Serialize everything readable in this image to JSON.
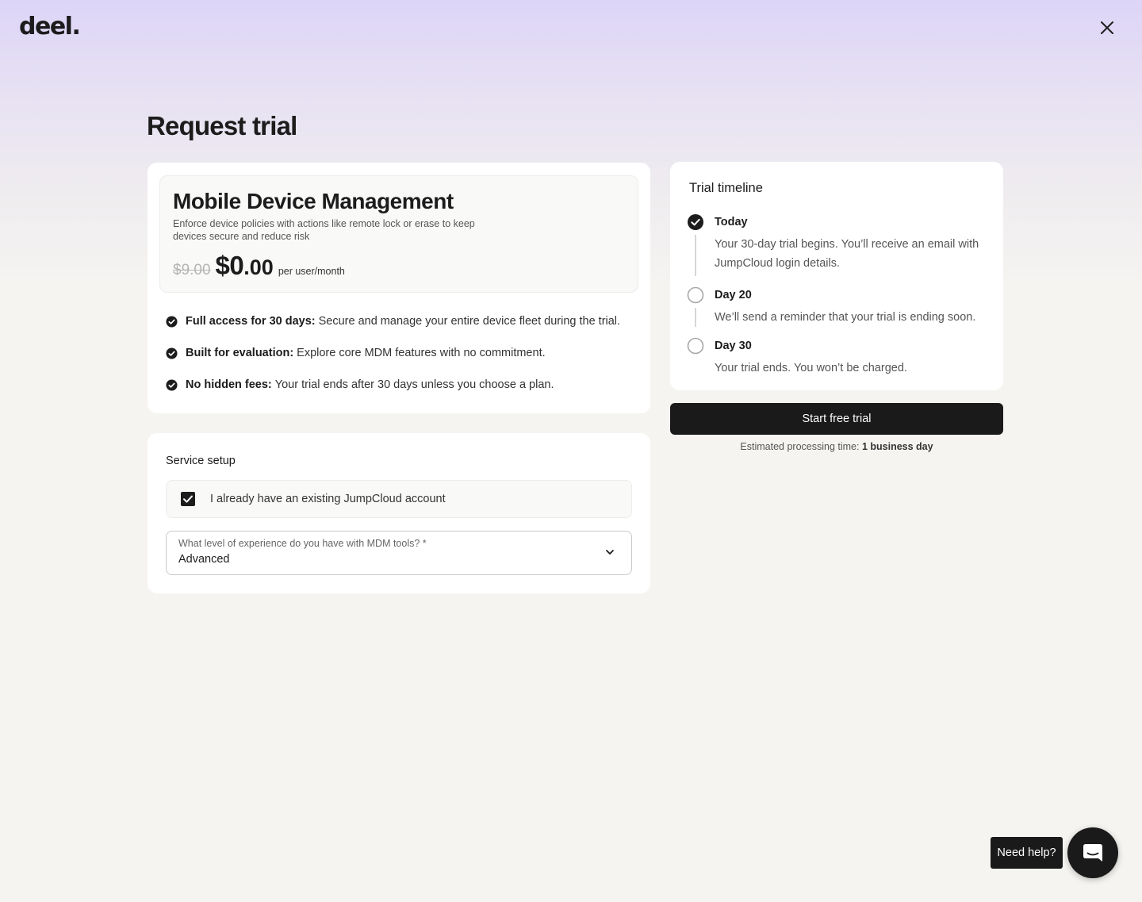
{
  "brand": {
    "logo": "deel."
  },
  "header": {
    "close_icon": "close-icon"
  },
  "page": {
    "title": "Request trial"
  },
  "product": {
    "name": "Mobile Device Management",
    "description": "Enforce device policies with actions like remote lock or erase to keep devices secure and reduce risk",
    "old_price": "$9.00",
    "new_price_major": "$0",
    "new_price_minor": ".00",
    "price_unit": "per user/month",
    "features": [
      {
        "title": "Full access for 30 days:",
        "text": "Secure and manage your entire device fleet during the trial."
      },
      {
        "title": "Built for evaluation:",
        "text": "Explore core MDM features with no commitment."
      },
      {
        "title": "No hidden fees:",
        "text": "Your trial ends after 30 days unless you choose a plan."
      }
    ]
  },
  "setup": {
    "title": "Service setup",
    "checkbox_label": "I already have an existing JumpCloud account",
    "checkbox_checked": true,
    "select_label": "What level of experience do you have with MDM tools? *",
    "select_value": "Advanced"
  },
  "timeline": {
    "title": "Trial timeline",
    "steps": [
      {
        "label": "Today",
        "description": "Your 30-day trial begins. You’ll receive an email with JumpCloud login details.",
        "completed": true
      },
      {
        "label": "Day 20",
        "description": "We’ll send a reminder that your trial is ending soon.",
        "completed": false
      },
      {
        "label": "Day 30",
        "description": "Your trial ends. You won’t be charged.",
        "completed": false
      }
    ]
  },
  "cta": {
    "start_label": "Start free trial",
    "processing_prefix": "Estimated processing time:",
    "processing_value": "1 business day"
  },
  "help": {
    "label": "Need help?",
    "icon": "chat-icon"
  },
  "colors": {
    "primary": "#1a1a1a",
    "header_gradient": "#ddd5f7",
    "background": "#f5f4f1"
  }
}
